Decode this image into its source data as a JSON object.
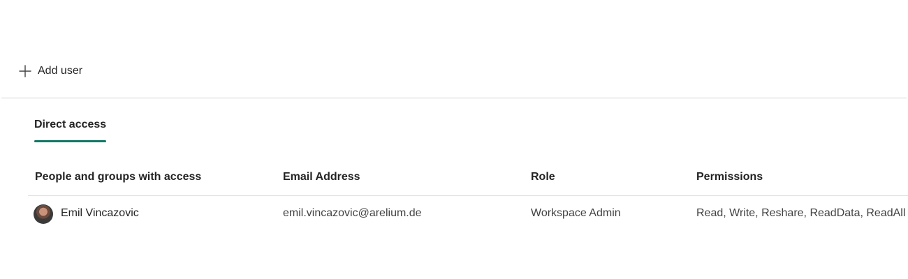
{
  "toolbar": {
    "add_user_label": "Add user"
  },
  "tabs": [
    {
      "label": "Direct access",
      "selected": true
    }
  ],
  "table": {
    "columns": [
      "People and groups with access",
      "Email Address",
      "Role",
      "Permissions"
    ],
    "rows": [
      {
        "name": "Emil Vincazovic",
        "email": "emil.vincazovic@arelium.de",
        "role": "Workspace Admin",
        "permissions": "Read, Write, Reshare, ReadData, ReadAll"
      }
    ]
  },
  "colors": {
    "accent": "#117865",
    "text": "#242424",
    "divider": "#d1d1d1"
  },
  "icons": {
    "add": "plus-icon"
  }
}
